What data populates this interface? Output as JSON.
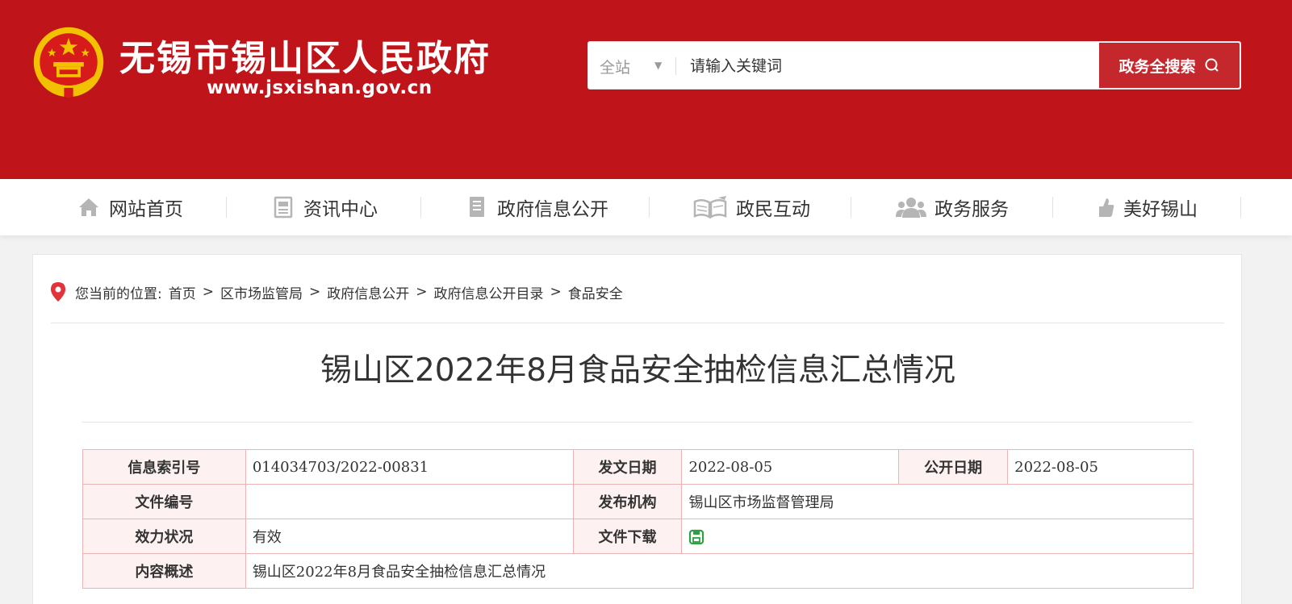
{
  "header": {
    "site_title": "无锡市锡山区人民政府",
    "site_url": "www.jsxishan.gov.cn",
    "brand_color": "#bf1419"
  },
  "search": {
    "scope": "全站",
    "placeholder": "请输入关键词",
    "button_label": "政务全搜索"
  },
  "nav": {
    "items": [
      {
        "label": "网站首页",
        "icon": "home-icon"
      },
      {
        "label": "资讯中心",
        "icon": "document-icon"
      },
      {
        "label": "政府信息公开",
        "icon": "file-icon"
      },
      {
        "label": "政民互动",
        "icon": "open-book-icon"
      },
      {
        "label": "政务服务",
        "icon": "people-icon"
      },
      {
        "label": "美好锡山",
        "icon": "thumbs-up-icon"
      }
    ]
  },
  "breadcrumb": {
    "prefix": "您当前的位置:",
    "items": [
      "首页",
      "区市场监管局",
      "政府信息公开",
      "政府信息公开目录",
      "食品安全"
    ],
    "separator": ">"
  },
  "document": {
    "title": "锡山区2022年8月食品安全抽检信息汇总情况"
  },
  "meta_table": {
    "index_label": "信息索引号",
    "index_value": "014034703/2022-00831",
    "issue_date_label": "发文日期",
    "issue_date_value": "2022-08-05",
    "public_date_label": "公开日期",
    "public_date_value": "2022-08-05",
    "doc_number_label": "文件编号",
    "doc_number_value": "",
    "publisher_label": "发布机构",
    "publisher_value": "锡山区市场监督管理局",
    "validity_label": "效力状况",
    "validity_value": "有效",
    "download_label": "文件下载",
    "summary_label": "内容概述",
    "summary_value": "锡山区2022年8月食品安全抽检信息汇总情况"
  }
}
